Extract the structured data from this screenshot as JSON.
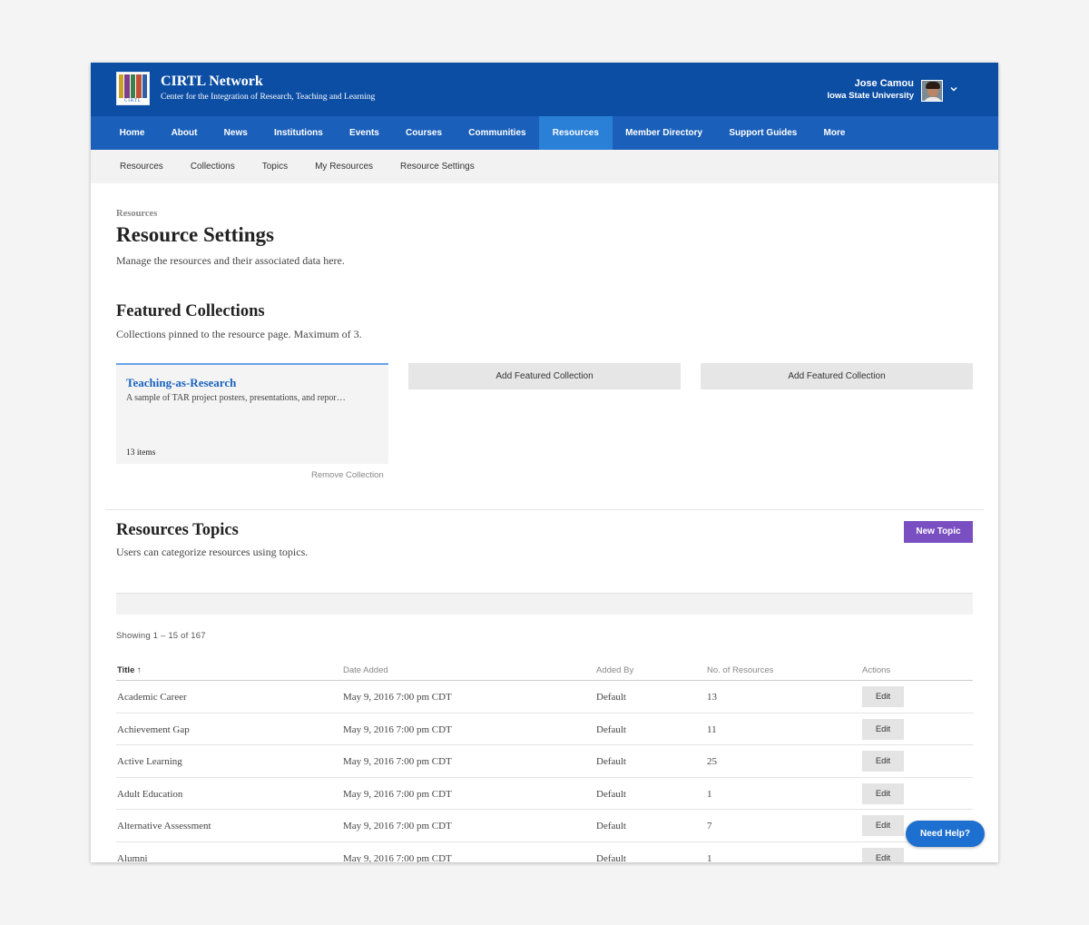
{
  "header": {
    "logo_wordmark": "CIRTL",
    "site_title": "CIRTL Network",
    "site_subtitle": "Center for the Integration of Research, Teaching and Learning",
    "user_name": "Jose Camou",
    "user_org": "Iowa State University",
    "brand_color": "#0c4ea4"
  },
  "main_nav": {
    "items": [
      "Home",
      "About",
      "News",
      "Institutions",
      "Events",
      "Courses",
      "Communities",
      "Resources",
      "Member Directory",
      "Support Guides",
      "More"
    ],
    "active": "Resources"
  },
  "sub_nav": {
    "items": [
      "Resources",
      "Collections",
      "Topics",
      "My Resources",
      "Resource Settings"
    ]
  },
  "page": {
    "breadcrumb": "Resources",
    "title": "Resource Settings",
    "description": "Manage the resources and their associated data here."
  },
  "featured": {
    "title": "Featured Collections",
    "description": "Collections pinned to the resource page. Maximum of 3.",
    "card": {
      "title": "Teaching-as-Research",
      "description": "A sample of TAR project posters, presentations, and repor…",
      "count": "13 items",
      "remove_label": "Remove Collection"
    },
    "add_label": "Add Featured Collection"
  },
  "topics": {
    "title": "Resources Topics",
    "description": "Users can categorize resources using topics.",
    "new_label": "New Topic",
    "showing": "Showing 1 – 15 of 167",
    "columns": {
      "title": "Title ↑",
      "date": "Date Added",
      "by": "Added By",
      "count": "No. of Resources",
      "actions": "Actions"
    },
    "edit_label": "Edit",
    "rows": [
      {
        "title": "Academic Career",
        "date": "May 9, 2016 7:00 pm CDT",
        "by": "Default",
        "count": "13"
      },
      {
        "title": "Achievement Gap",
        "date": "May 9, 2016 7:00 pm CDT",
        "by": "Default",
        "count": "11"
      },
      {
        "title": "Active Learning",
        "date": "May 9, 2016 7:00 pm CDT",
        "by": "Default",
        "count": "25"
      },
      {
        "title": "Adult Education",
        "date": "May 9, 2016 7:00 pm CDT",
        "by": "Default",
        "count": "1"
      },
      {
        "title": "Alternative Assessment",
        "date": "May 9, 2016 7:00 pm CDT",
        "by": "Default",
        "count": "7"
      },
      {
        "title": "Alumni",
        "date": "May 9, 2016 7:00 pm CDT",
        "by": "Default",
        "count": "1"
      }
    ]
  },
  "help": {
    "label": "Need Help?"
  },
  "colors": {
    "accent_purple": "#7a4fc2",
    "link_blue": "#1a63bf",
    "nav_active": "#2a7fd6"
  }
}
